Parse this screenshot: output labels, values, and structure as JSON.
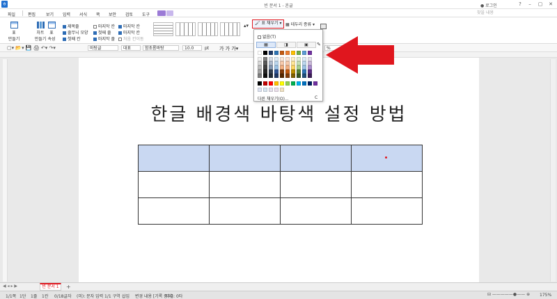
{
  "app": {
    "title": "빈 문서 1 - 흔글",
    "login": "로그인",
    "logo": "ㅎ"
  },
  "window_controls": [
    "?",
    "–",
    "▢",
    "✕"
  ],
  "menu": [
    "파일",
    "편집",
    "보기",
    "입력",
    "서식",
    "쪽",
    "보안",
    "검토",
    "도구"
  ],
  "search": {
    "placeholder": "찾을 내용"
  },
  "ribbon": {
    "create_table": "표\n만들기",
    "chart": "차트\n만들기",
    "table_props": "표\n속성",
    "checks": [
      {
        "label": "제목줄",
        "on": true
      },
      {
        "label": "줄무늬 모양",
        "on": true
      },
      {
        "label": "첫째 칸",
        "on": true
      },
      {
        "label": "마지막 칸",
        "on": false
      },
      {
        "label": "첫째 줄",
        "on": false
      },
      {
        "label": "마지막 줄",
        "on": true
      },
      {
        "label": "마지막 칸",
        "on": true
      },
      {
        "label": "처음 칸이동",
        "on": false
      },
      {
        "label": "줄무늬",
        "on": false
      }
    ],
    "fill_btn": "표 채우기",
    "border_btn": "테두리 종류"
  },
  "format_bar": {
    "style": "바탕글",
    "lang": "대표",
    "font": "함초롬바탕",
    "size": "10.0",
    "unit": "pt",
    "zoom_pct": "%"
  },
  "dropdown": {
    "none_label": "없음(T)",
    "tabs": [
      "▦",
      "◨",
      "▣"
    ],
    "more_label": "다른 채우기(O)...",
    "more_key": "C",
    "palette_top": [
      "#ffffff",
      "#000000",
      "#1f3864",
      "#2e74b5",
      "#c55a11",
      "#ed7d31",
      "#ffc000",
      "#70ad47",
      "#5b9bd5",
      "#7030a0"
    ],
    "palette_shades": [
      [
        "#f2f2f2",
        "#7f7f7f",
        "#d6dce5",
        "#deebf7",
        "#fbe5d6",
        "#fce4d6",
        "#fff2cc",
        "#e2f0d9",
        "#ddebf7",
        "#e4dfec"
      ],
      [
        "#d9d9d9",
        "#595959",
        "#adb9ca",
        "#bdd7ee",
        "#f8cbad",
        "#f8cbad",
        "#ffe699",
        "#c5e0b4",
        "#bdd7ee",
        "#c9b8da"
      ],
      [
        "#bfbfbf",
        "#404040",
        "#8497b0",
        "#9dc3e6",
        "#f4b183",
        "#f4b183",
        "#ffd966",
        "#a9d18e",
        "#9dc3e6",
        "#a98bcc"
      ],
      [
        "#a6a6a6",
        "#262626",
        "#333f50",
        "#2f5597",
        "#843c0c",
        "#c55a11",
        "#bf9000",
        "#548235",
        "#2e75b6",
        "#5b2d84"
      ],
      [
        "#7f7f7f",
        "#0d0d0d",
        "#222a35",
        "#1f3864",
        "#562700",
        "#833c0b",
        "#7f6000",
        "#375623",
        "#1f4e79",
        "#3c1e57"
      ]
    ],
    "palette_std": [
      "#000000",
      "#c00000",
      "#ff0000",
      "#ffc000",
      "#ffff00",
      "#92d050",
      "#00b050",
      "#00b0f0",
      "#0070c0",
      "#002060",
      "#7030a0"
    ],
    "palette_recent": [
      "#dee4f2",
      "#d9e5f0",
      "#e5e1ec",
      "#ebe0ec",
      "#f1e3c4"
    ]
  },
  "document": {
    "title": "한글 배경색 바탕색 설정 방법",
    "header_fill": "#c9d8f2"
  },
  "tabs": {
    "doc": "빈 문서 1",
    "add": "+"
  },
  "status": [
    "1/1쪽",
    "1단",
    "1줄",
    "1칸",
    "0/18글자",
    "(미): 문자 입력",
    "1/1 구역",
    "삽입",
    "변경 내용 [기록 중지]",
    "타수: 0타"
  ],
  "zoom": "175%"
}
